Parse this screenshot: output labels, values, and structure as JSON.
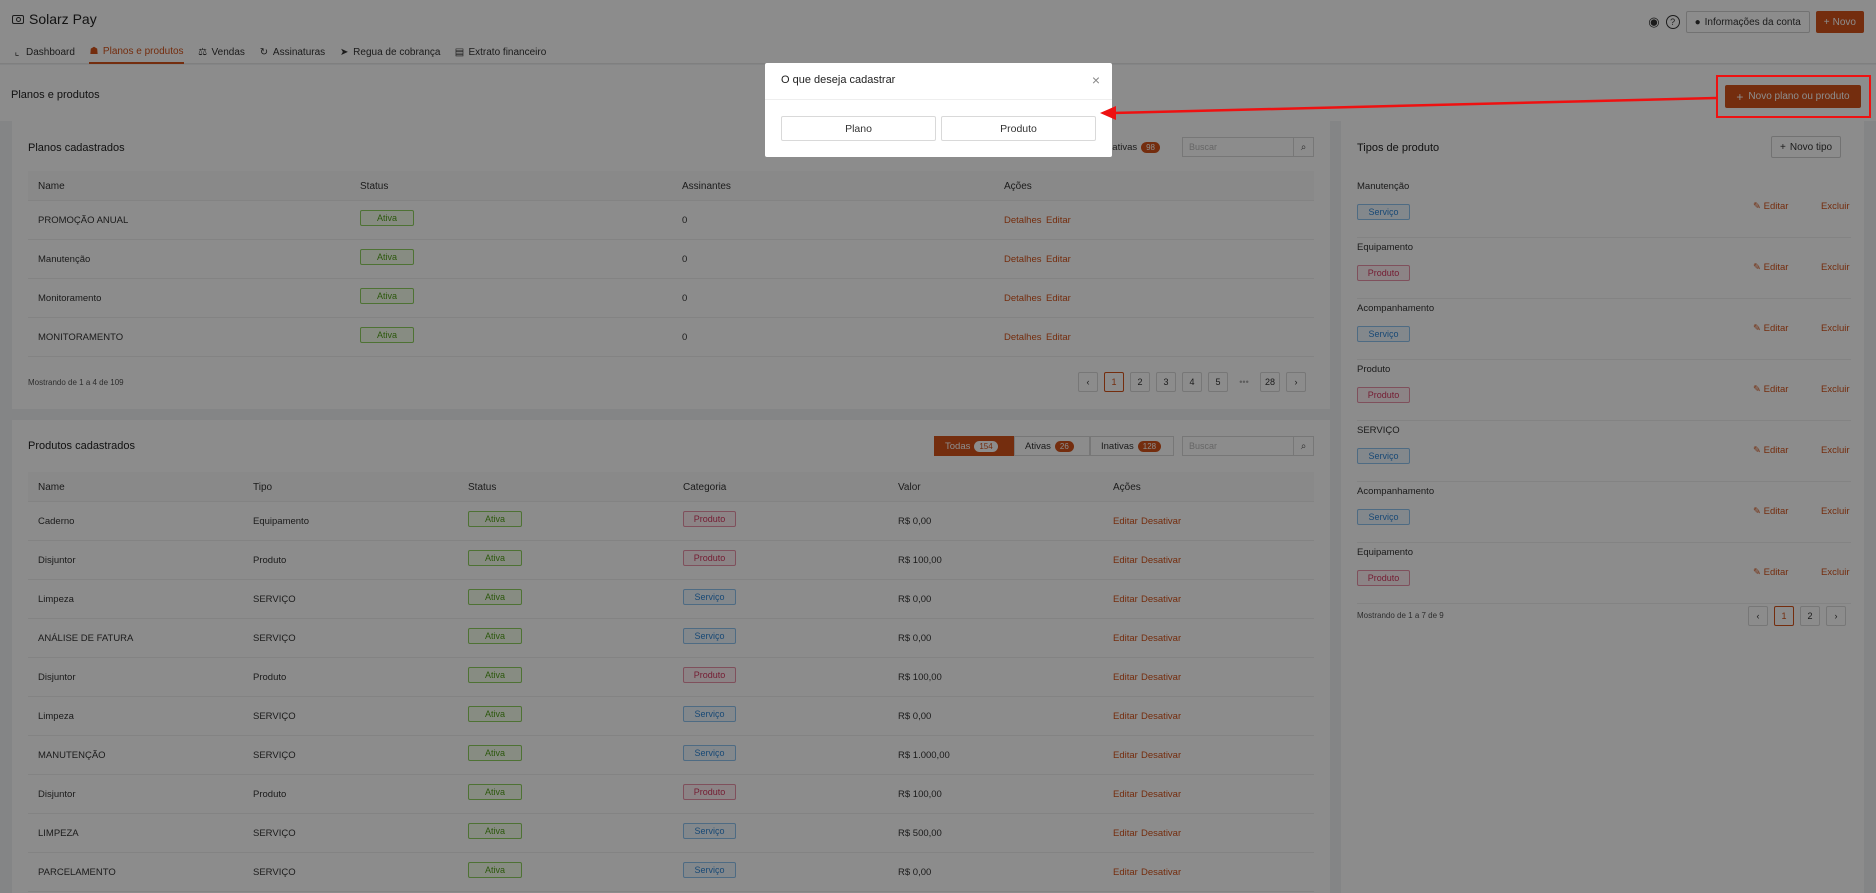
{
  "app": {
    "title": "Solarz Pay"
  },
  "nav": [
    {
      "label": "Dashboard",
      "icon": "chart-icon"
    },
    {
      "label": "Planos e produtos",
      "icon": "plans-icon"
    },
    {
      "label": "Vendas",
      "icon": "sales-icon"
    },
    {
      "label": "Assinaturas",
      "icon": "refresh-icon"
    },
    {
      "label": "Regua de cobrança",
      "icon": "send-icon"
    },
    {
      "label": "Extrato financeiro",
      "icon": "statement-icon"
    }
  ],
  "header_right": {
    "account_label": "Informações da conta",
    "new_label": "Novo"
  },
  "page": {
    "title": "Planos e produtos",
    "new_button": "Novo plano ou produto"
  },
  "plans": {
    "title": "Planos cadastrados",
    "filter_visible_label": "nativas",
    "filter_visible_count": "98",
    "search_placeholder": "Buscar",
    "columns": [
      "Name",
      "Status",
      "Assinantes",
      "Ações"
    ],
    "rows": [
      {
        "name": "PROMOÇÃO ANUAL",
        "status": "Ativa",
        "subs": "0",
        "a1": "Detalhes",
        "a2": "Editar"
      },
      {
        "name": "Manutenção",
        "status": "Ativa",
        "subs": "0",
        "a1": "Detalhes",
        "a2": "Editar"
      },
      {
        "name": "Monitoramento",
        "status": "Ativa",
        "subs": "0",
        "a1": "Detalhes",
        "a2": "Editar"
      },
      {
        "name": "MONITORAMENTO",
        "status": "Ativa",
        "subs": "0",
        "a1": "Detalhes",
        "a2": "Editar"
      }
    ],
    "showing": "Mostrando de 1 a 4 de 109",
    "pages": [
      "1",
      "2",
      "3",
      "4",
      "5",
      "28"
    ]
  },
  "products": {
    "title": "Produtos cadastrados",
    "filters": [
      {
        "label": "Todas",
        "count": "154"
      },
      {
        "label": "Ativas",
        "count": "26"
      },
      {
        "label": "Inativas",
        "count": "128"
      }
    ],
    "search_placeholder": "Buscar",
    "columns": [
      "Name",
      "Tipo",
      "Status",
      "Categoria",
      "Valor",
      "Ações"
    ],
    "rows": [
      {
        "name": "Caderno",
        "tipo": "Equipamento",
        "status": "Ativa",
        "cat": "Produto",
        "valor": "R$ 0,00"
      },
      {
        "name": "Disjuntor",
        "tipo": "Produto",
        "status": "Ativa",
        "cat": "Produto",
        "valor": "R$ 100,00"
      },
      {
        "name": "Limpeza",
        "tipo": "SERVIÇO",
        "status": "Ativa",
        "cat": "Serviço",
        "valor": "R$ 0,00"
      },
      {
        "name": "ANÁLISE DE FATURA",
        "tipo": "SERVIÇO",
        "status": "Ativa",
        "cat": "Serviço",
        "valor": "R$ 0,00"
      },
      {
        "name": "Disjuntor",
        "tipo": "Produto",
        "status": "Ativa",
        "cat": "Produto",
        "valor": "R$ 100,00"
      },
      {
        "name": "Limpeza",
        "tipo": "SERVIÇO",
        "status": "Ativa",
        "cat": "Serviço",
        "valor": "R$ 0,00"
      },
      {
        "name": "MANUTENÇÃO",
        "tipo": "SERVIÇO",
        "status": "Ativa",
        "cat": "Serviço",
        "valor": "R$ 1.000,00"
      },
      {
        "name": "Disjuntor",
        "tipo": "Produto",
        "status": "Ativa",
        "cat": "Produto",
        "valor": "R$ 100,00"
      },
      {
        "name": "LIMPEZA",
        "tipo": "SERVIÇO",
        "status": "Ativa",
        "cat": "Serviço",
        "valor": "R$ 500,00"
      },
      {
        "name": "PARCELAMENTO",
        "tipo": "SERVIÇO",
        "status": "Ativa",
        "cat": "Serviço",
        "valor": "R$ 0,00"
      }
    ],
    "action_edit": "Editar",
    "action_disable": "Desativar"
  },
  "types": {
    "title": "Tipos de produto",
    "new_button": "Novo tipo",
    "items": [
      {
        "name": "Manutenção",
        "cat": "Serviço"
      },
      {
        "name": "Equipamento",
        "cat": "Produto"
      },
      {
        "name": "Acompanhamento",
        "cat": "Serviço"
      },
      {
        "name": "Produto",
        "cat": "Produto"
      },
      {
        "name": "SERVIÇO",
        "cat": "Serviço"
      },
      {
        "name": "Acompanhamento",
        "cat": "Serviço"
      },
      {
        "name": "Equipamento",
        "cat": "Produto"
      }
    ],
    "edit_label": "Editar",
    "delete_label": "Excluir",
    "showing": "Mostrando de 1 a 7 de 9",
    "pages": [
      "1",
      "2"
    ]
  },
  "modal": {
    "title": "O que deseja cadastrar",
    "option_plan": "Plano",
    "option_product": "Produto"
  },
  "colors": {
    "accent": "#d4531b",
    "highlight": "#ee1111"
  }
}
